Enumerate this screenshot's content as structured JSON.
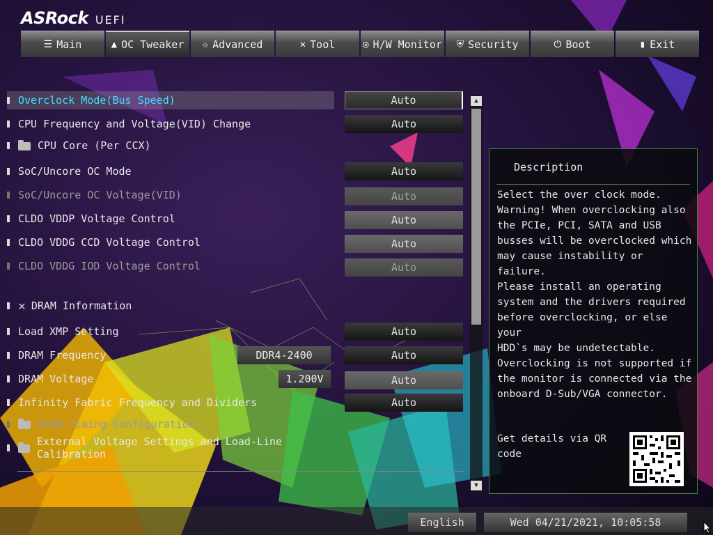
{
  "brand": {
    "logo": "ASRock",
    "product": "UEFI"
  },
  "tabs": [
    {
      "label": "Main",
      "icon": "list-icon"
    },
    {
      "label": "OC Tweaker",
      "icon": "rocket-icon",
      "active": true
    },
    {
      "label": "Advanced",
      "icon": "star-icon"
    },
    {
      "label": "Tool",
      "icon": "tools-icon"
    },
    {
      "label": "H/W Monitor",
      "icon": "globe-icon"
    },
    {
      "label": "Security",
      "icon": "shield-icon"
    },
    {
      "label": "Boot",
      "icon": "power-icon"
    },
    {
      "label": "Exit",
      "icon": "exit-door-icon"
    }
  ],
  "settings": [
    {
      "label": "Overclock Mode(Bus Speed)",
      "value": "Auto"
    },
    {
      "label": "CPU Frequency and Voltage(VID) Change",
      "value": "Auto"
    },
    {
      "label": "CPU Core (Per CCX)"
    },
    {
      "label": "SoC/Uncore OC Mode",
      "value": "Auto"
    },
    {
      "label": "SoC/Uncore OC Voltage(VID)",
      "value": "Auto"
    },
    {
      "label": "CLDO VDDP Voltage Control",
      "value": "Auto"
    },
    {
      "label": "CLDO VDDG CCD Voltage Control",
      "value": "Auto"
    },
    {
      "label": "CLDO VDDG IOD Voltage Control",
      "value": "Auto"
    },
    {
      "label": "DRAM Information"
    },
    {
      "label": "Load XMP Setting",
      "value": "Auto"
    },
    {
      "label": "DRAM Frequency",
      "info": "DDR4-2400",
      "value": "Auto"
    },
    {
      "label": "DRAM Voltage",
      "info": "1.200V",
      "value": "Auto"
    },
    {
      "label": "Infinity Fabric Frequency and Dividers",
      "value": "Auto"
    },
    {
      "label": "DRAM Timing Configuration"
    },
    {
      "label": "External Voltage Settings and Load-Line Calibration"
    }
  ],
  "description": {
    "title": "Description",
    "text": "Select the over clock mode.\nWarning! When overclocking also\nthe PCIe, PCI, SATA and USB\nbusses will be overclocked which\nmay cause instability or failure.\nPlease install an operating\nsystem and the drivers required\nbefore overclocking, or else your\nHDD`s may be undetectable.\nOverclocking is not supported if\nthe monitor is connected via the\nonboard D-Sub/VGA connector.",
    "qr_text": "Get details via QR code"
  },
  "footer": {
    "language": "English",
    "datetime": "Wed 04/21/2021, 10:05:58"
  },
  "colors": {
    "highlight_text": "#3fe0ff",
    "panel_border": "#4a7a4a"
  }
}
